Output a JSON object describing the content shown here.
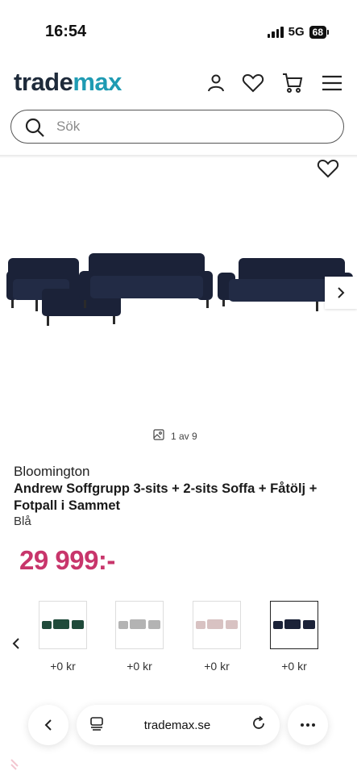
{
  "status": {
    "time": "16:54",
    "network": "5G",
    "battery": "68"
  },
  "header": {
    "logo_part1": "trade",
    "logo_part2": "max"
  },
  "search": {
    "placeholder": "Sök"
  },
  "gallery": {
    "counter": "1 av 9"
  },
  "product": {
    "brand": "Bloomington",
    "title": "Andrew Soffgrupp 3-sits + 2-sits Soffa + Fåtölj + Fotpall i Sammet",
    "color": "Blå",
    "price": "29 999:-"
  },
  "variants": [
    {
      "name": "green",
      "price": "+0 kr",
      "color": "#1f4a3a"
    },
    {
      "name": "grey",
      "price": "+0 kr",
      "color": "#b3b3b3"
    },
    {
      "name": "pink",
      "price": "+0 kr",
      "color": "#d8c2c2"
    },
    {
      "name": "navy",
      "price": "+0 kr",
      "color": "#1b2238"
    }
  ],
  "browser": {
    "url": "trademax.se"
  },
  "colors": {
    "accent": "#1f9bb3",
    "price": "#c8356b",
    "sofa": "#1b2238"
  }
}
